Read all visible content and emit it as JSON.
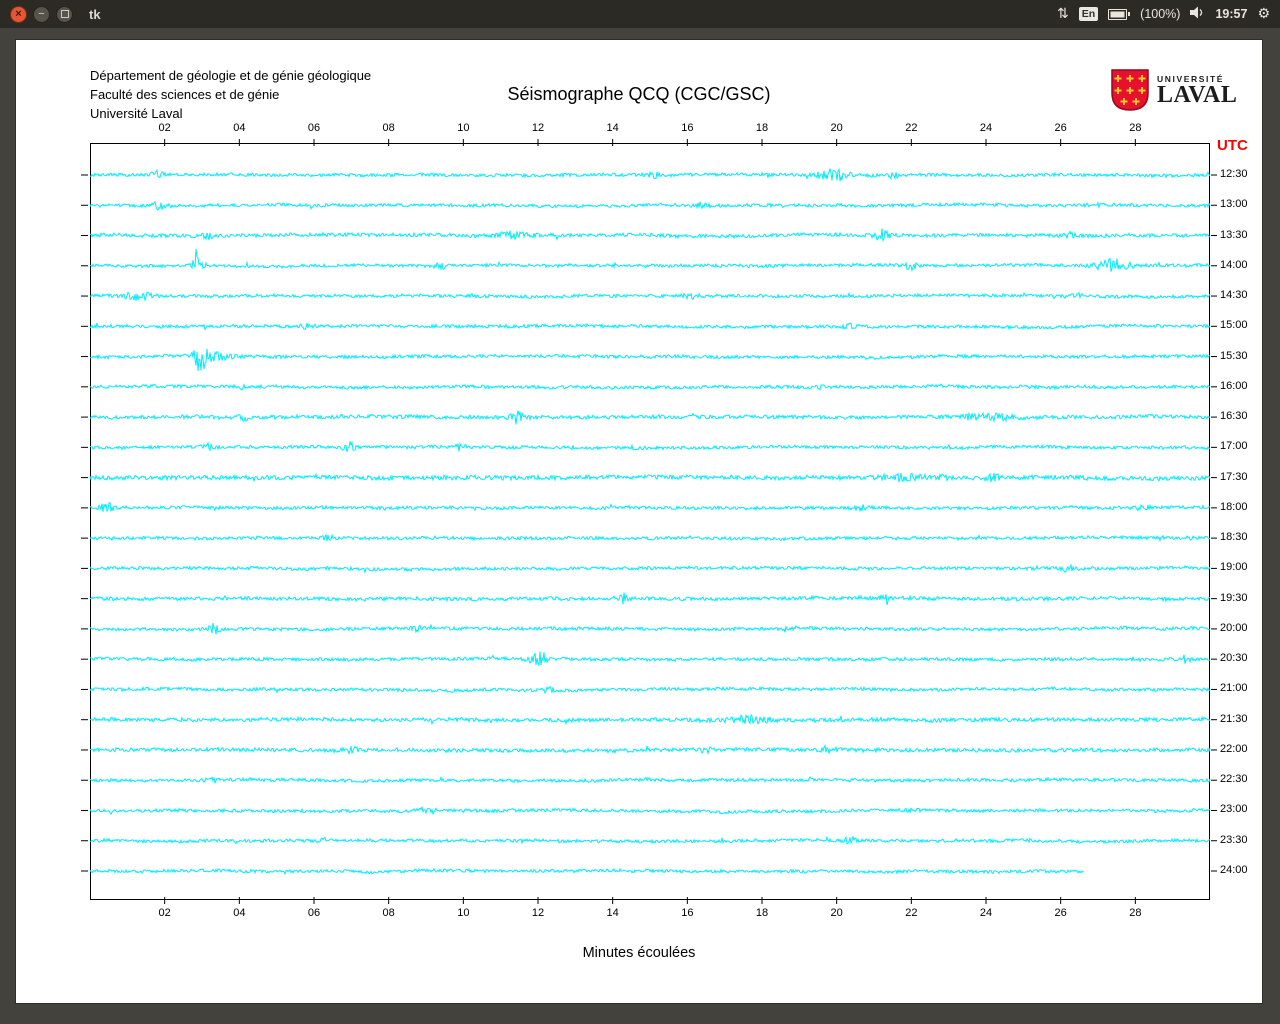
{
  "titlebar": {
    "title": "tk",
    "keyboard": "En",
    "battery": "(100%)",
    "time": "19:57"
  },
  "window": {
    "header_lines": [
      "Département de géologie et de génie géologique",
      "Faculté des sciences et de génie",
      "Université Laval"
    ],
    "title": "Séismographe QCQ (CGC/GSC)",
    "logo": {
      "top": "UNIVERSITÉ",
      "bottom": "LAVAL"
    },
    "utc_label": "UTC",
    "xlabel": "Minutes écoulées"
  },
  "chart_data": {
    "type": "line",
    "title": "Séismographe QCQ (CGC/GSC)",
    "xlabel": "Minutes écoulées",
    "ylabel_right": "UTC",
    "x_range_minutes": [
      0,
      30
    ],
    "x_ticks": [
      "02",
      "04",
      "06",
      "08",
      "10",
      "12",
      "14",
      "16",
      "18",
      "20",
      "22",
      "24",
      "26",
      "28"
    ],
    "trace_color": "#00eaff",
    "rows": [
      {
        "utc": "12:30",
        "events": [
          {
            "min": 1.8,
            "amp": 3
          },
          {
            "min": 15.1,
            "amp": 2.5
          },
          {
            "min": 19.9,
            "amp": 6,
            "w": 0.25
          },
          {
            "min": 21.5,
            "amp": 2.5
          }
        ]
      },
      {
        "utc": "13:00",
        "events": [
          {
            "min": 1.85,
            "amp": 4.5
          },
          {
            "min": 16.4,
            "amp": 2.5
          },
          {
            "min": 26.9,
            "amp": 2.5
          }
        ]
      },
      {
        "utc": "13:30",
        "base": 1.8,
        "events": [
          {
            "min": 3.1,
            "amp": 2.5
          },
          {
            "min": 11.4,
            "amp": 3,
            "w": 0.3
          },
          {
            "min": 21.2,
            "amp": 5
          },
          {
            "min": 26.3,
            "amp": 2.5
          }
        ]
      },
      {
        "utc": "14:00",
        "events": [
          {
            "min": 2.9,
            "amp": 8
          },
          {
            "min": 9.4,
            "amp": 3
          },
          {
            "min": 22.0,
            "amp": 3
          },
          {
            "min": 27.4,
            "amp": 6,
            "w": 0.3
          }
        ]
      },
      {
        "utc": "14:30",
        "events": [
          {
            "min": 1.3,
            "amp": 4,
            "w": 0.3
          },
          {
            "min": 16.1,
            "amp": 2.5
          },
          {
            "min": 26.5,
            "amp": 2
          }
        ]
      },
      {
        "utc": "15:00",
        "events": [
          {
            "min": 5.8,
            "amp": 2
          },
          {
            "min": 20.4,
            "amp": 2.5
          }
        ]
      },
      {
        "utc": "15:30",
        "events": [
          {
            "min": 2.95,
            "amp": 15,
            "w": 0.1
          },
          {
            "min": 3.3,
            "amp": 4,
            "w": 0.3
          }
        ]
      },
      {
        "utc": "16:00",
        "events": [
          {
            "min": 4.0,
            "amp": 2
          },
          {
            "min": 19.5,
            "amp": 2.5
          }
        ]
      },
      {
        "utc": "16:30",
        "base": 1.9,
        "events": [
          {
            "min": 4.1,
            "amp": 2.5
          },
          {
            "min": 11.45,
            "amp": 7
          },
          {
            "min": 24.0,
            "amp": 3,
            "w": 0.5
          }
        ]
      },
      {
        "utc": "17:00",
        "events": [
          {
            "min": 3.2,
            "amp": 2.5
          },
          {
            "min": 6.95,
            "amp": 4.5
          },
          {
            "min": 9.9,
            "amp": 3
          }
        ]
      },
      {
        "utc": "17:30",
        "base": 2.2,
        "events": [
          {
            "min": 21.8,
            "amp": 3,
            "w": 0.4
          },
          {
            "min": 22.8,
            "amp": 3
          },
          {
            "min": 24.2,
            "amp": 3
          }
        ]
      },
      {
        "utc": "18:00",
        "events": [
          {
            "min": 0.45,
            "amp": 4.5
          },
          {
            "min": 20.6,
            "amp": 2.5
          },
          {
            "min": 28.2,
            "amp": 3
          }
        ]
      },
      {
        "utc": "18:30",
        "events": [
          {
            "min": 6.4,
            "amp": 2
          }
        ]
      },
      {
        "utc": "19:00",
        "events": [
          {
            "min": 26.2,
            "amp": 3
          }
        ]
      },
      {
        "utc": "19:30",
        "base": 1.8,
        "events": [
          {
            "min": 14.3,
            "amp": 5
          },
          {
            "min": 21.3,
            "amp": 2.5
          }
        ]
      },
      {
        "utc": "20:00",
        "events": [
          {
            "min": 3.3,
            "amp": 4
          },
          {
            "min": 8.8,
            "amp": 2.5
          },
          {
            "min": 18.7,
            "amp": 3
          }
        ]
      },
      {
        "utc": "20:30",
        "events": [
          {
            "min": 12.05,
            "amp": 6,
            "w": 0.2
          },
          {
            "min": 29.3,
            "amp": 3
          }
        ]
      },
      {
        "utc": "21:00",
        "events": [
          {
            "min": 12.3,
            "amp": 3
          }
        ]
      },
      {
        "utc": "21:30",
        "base": 1.9,
        "events": [
          {
            "min": 17.6,
            "amp": 3.5,
            "w": 0.4
          }
        ]
      },
      {
        "utc": "22:00",
        "base": 1.9,
        "events": [
          {
            "min": 7.0,
            "amp": 3
          },
          {
            "min": 16.5,
            "amp": 3
          },
          {
            "min": 19.8,
            "amp": 3.5
          }
        ]
      },
      {
        "utc": "22:30",
        "events": [
          {
            "min": 3.3,
            "amp": 2.5
          }
        ]
      },
      {
        "utc": "23:00",
        "events": [
          {
            "min": 9.0,
            "amp": 2
          },
          {
            "min": 22.0,
            "amp": 2.5
          }
        ]
      },
      {
        "utc": "23:30",
        "events": [
          {
            "min": 6.3,
            "amp": 2
          },
          {
            "min": 20.4,
            "amp": 3.5
          }
        ]
      },
      {
        "utc": "24:00",
        "end_min": 26.6,
        "events": []
      }
    ]
  }
}
